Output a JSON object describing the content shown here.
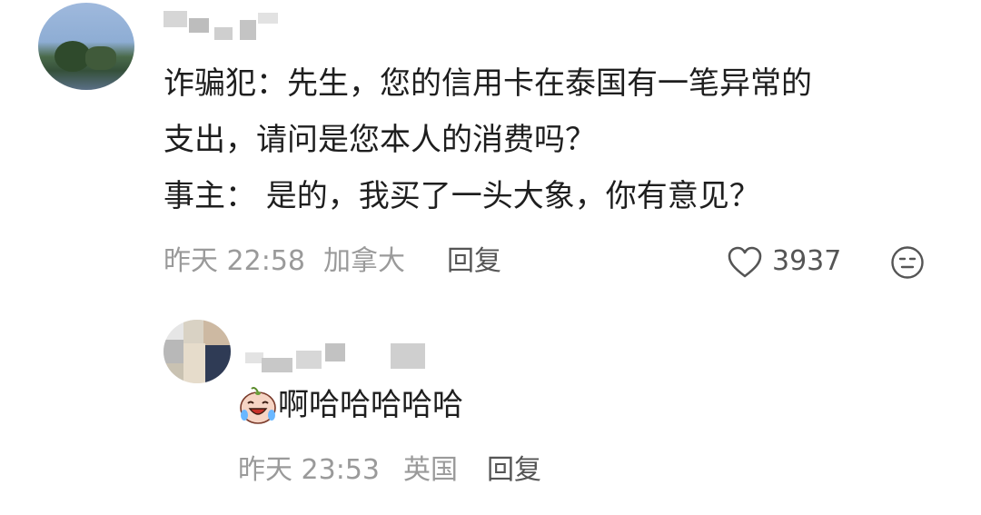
{
  "comment": {
    "line1": "诈骗犯：先生，您的信用卡在泰国有一笔异常的",
    "line2": "支出，请问是您本人的消费吗？",
    "line3": "事主： 是的，我买了一头大象，你有意见？",
    "time": "昨天 22:58",
    "location": "加拿大",
    "reply_label": "回复",
    "like_count": "3937"
  },
  "reply": {
    "text": "啊哈哈哈哈哈",
    "emoji_icon": "laughing-crying-emoji",
    "time": "昨天 23:53",
    "location": "英国",
    "reply_label": "回复"
  },
  "icons": {
    "like": "heart-outline-icon",
    "react": "face-icon"
  },
  "colors": {
    "text": "#1e1e1e",
    "meta": "#9a9a9a",
    "action": "#555555"
  }
}
